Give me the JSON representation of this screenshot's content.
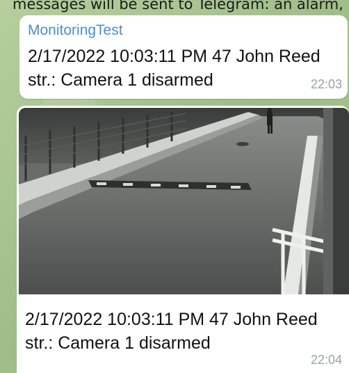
{
  "caption_above": "messages will be sent to Telegram: an alarm,",
  "messages": [
    {
      "sender": "MonitoringTest",
      "text": "2/17/2022 10:03:11 PM 47 John Reed str.: Camera 1 disarmed",
      "time": "22:03"
    },
    {
      "image_alt": "Camera snapshot of a road with a speed bump and a railing",
      "text": "2/17/2022 10:03:11 PM 47 John Reed str.: Camera 1 disarmed",
      "time": "22:04"
    }
  ],
  "colors": {
    "sender_name": "#4a90c9",
    "bubble": "#ffffff",
    "chat_background": "#a9c493",
    "time_text": "#9aa0a6"
  }
}
